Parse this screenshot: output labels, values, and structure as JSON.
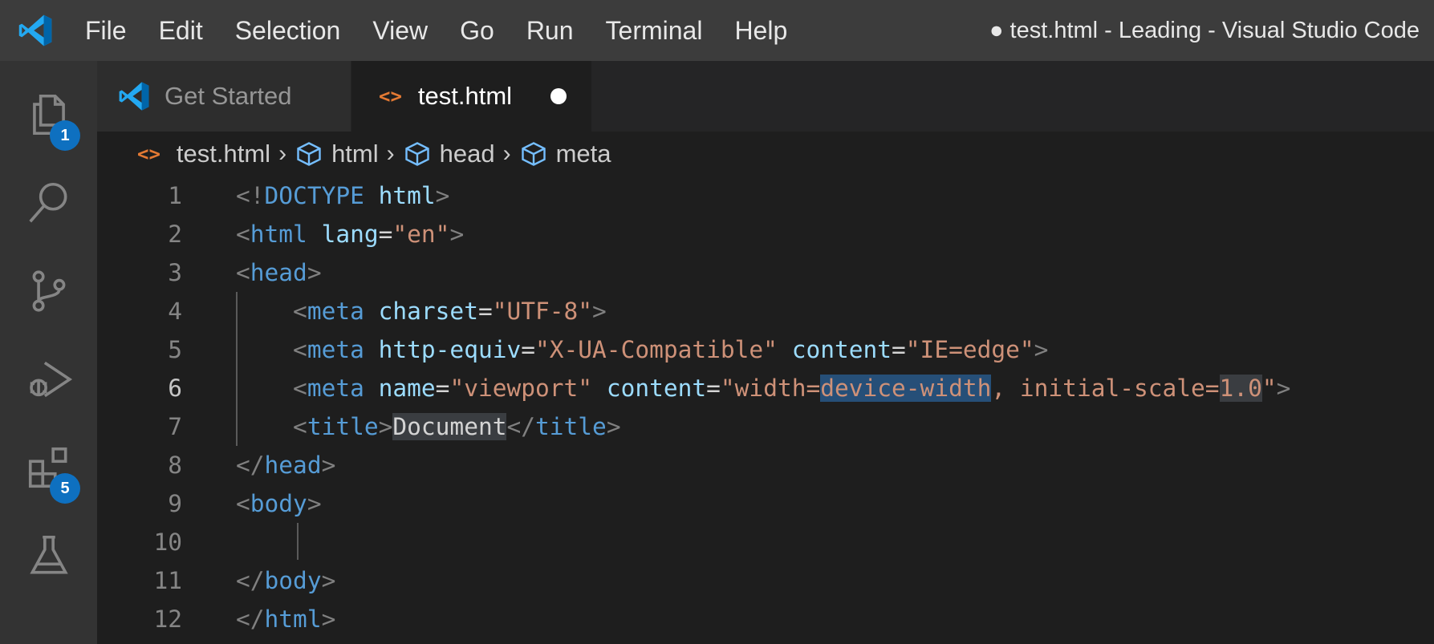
{
  "menu": [
    "File",
    "Edit",
    "Selection",
    "View",
    "Go",
    "Run",
    "Terminal",
    "Help"
  ],
  "window_title": "● test.html - Leading - Visual Studio Code",
  "activity": {
    "explorer_badge": "1",
    "extensions_badge": "5"
  },
  "tabs": [
    {
      "label": "Get Started",
      "icon": "vscode-logo-icon"
    },
    {
      "label": "test.html",
      "icon": "html-code-icon",
      "dirty": true
    }
  ],
  "breadcrumbs": [
    "test.html",
    "html",
    "head",
    "meta"
  ],
  "editor": {
    "current_line": 6,
    "line_numbers": [
      "1",
      "2",
      "3",
      "4",
      "5",
      "6",
      "7",
      "8",
      "9",
      "10",
      "11",
      "12"
    ],
    "lines": [
      [
        [
          "punc",
          "<!"
        ],
        [
          "tag",
          "DOCTYPE"
        ],
        [
          "txt",
          " "
        ],
        [
          "attr",
          "html"
        ],
        [
          "punc",
          ">"
        ]
      ],
      [
        [
          "punc",
          "<"
        ],
        [
          "tag",
          "html"
        ],
        [
          "txt",
          " "
        ],
        [
          "attr",
          "lang"
        ],
        [
          "txt",
          "="
        ],
        [
          "str",
          "\"en\""
        ],
        [
          "punc",
          ">"
        ]
      ],
      [
        [
          "punc",
          "<"
        ],
        [
          "tag",
          "head"
        ],
        [
          "punc",
          ">"
        ]
      ],
      [
        [
          "txt",
          "    "
        ],
        [
          "punc",
          "<"
        ],
        [
          "tag",
          "meta"
        ],
        [
          "txt",
          " "
        ],
        [
          "attr",
          "charset"
        ],
        [
          "txt",
          "="
        ],
        [
          "str",
          "\"UTF-8\""
        ],
        [
          "punc",
          ">"
        ]
      ],
      [
        [
          "txt",
          "    "
        ],
        [
          "punc",
          "<"
        ],
        [
          "tag",
          "meta"
        ],
        [
          "txt",
          " "
        ],
        [
          "attr",
          "http-equiv"
        ],
        [
          "txt",
          "="
        ],
        [
          "str",
          "\"X-UA-Compatible\""
        ],
        [
          "txt",
          " "
        ],
        [
          "attr",
          "content"
        ],
        [
          "txt",
          "="
        ],
        [
          "str",
          "\"IE=edge\""
        ],
        [
          "punc",
          ">"
        ]
      ],
      [
        [
          "txt",
          "    "
        ],
        [
          "punc",
          "<"
        ],
        [
          "tag",
          "meta"
        ],
        [
          "txt",
          " "
        ],
        [
          "attr",
          "name"
        ],
        [
          "txt",
          "="
        ],
        [
          "str",
          "\"viewport\""
        ],
        [
          "txt",
          " "
        ],
        [
          "attr",
          "content"
        ],
        [
          "txt",
          "="
        ],
        [
          "str",
          "\"width="
        ],
        [
          "str-sel",
          "device-width"
        ],
        [
          "str",
          ", initial-scale="
        ],
        [
          "str-word",
          "1.0"
        ],
        [
          "str",
          "\""
        ],
        [
          "punc",
          ">"
        ]
      ],
      [
        [
          "txt",
          "    "
        ],
        [
          "punc",
          "<"
        ],
        [
          "tag",
          "title"
        ],
        [
          "punc",
          ">"
        ],
        [
          "txt-word",
          "Document"
        ],
        [
          "punc",
          "</"
        ],
        [
          "tag",
          "title"
        ],
        [
          "punc",
          ">"
        ]
      ],
      [
        [
          "punc",
          "</"
        ],
        [
          "tag",
          "head"
        ],
        [
          "punc",
          ">"
        ]
      ],
      [
        [
          "punc",
          "<"
        ],
        [
          "tag",
          "body"
        ],
        [
          "punc",
          ">"
        ]
      ],
      [],
      [
        [
          "punc",
          "</"
        ],
        [
          "tag",
          "body"
        ],
        [
          "punc",
          ">"
        ]
      ],
      [
        [
          "punc",
          "</"
        ],
        [
          "tag",
          "html"
        ],
        [
          "punc",
          ">"
        ]
      ]
    ]
  },
  "colors": {
    "titlebar": "#3c3c3c",
    "activitybar": "#333333",
    "editor_bg": "#1e1e1e",
    "tag": "#569cd6",
    "attr": "#9cdcfe",
    "string": "#ce9178",
    "punctuation": "#808080",
    "badge": "#0e70c0",
    "html_icon": "#e37933"
  }
}
